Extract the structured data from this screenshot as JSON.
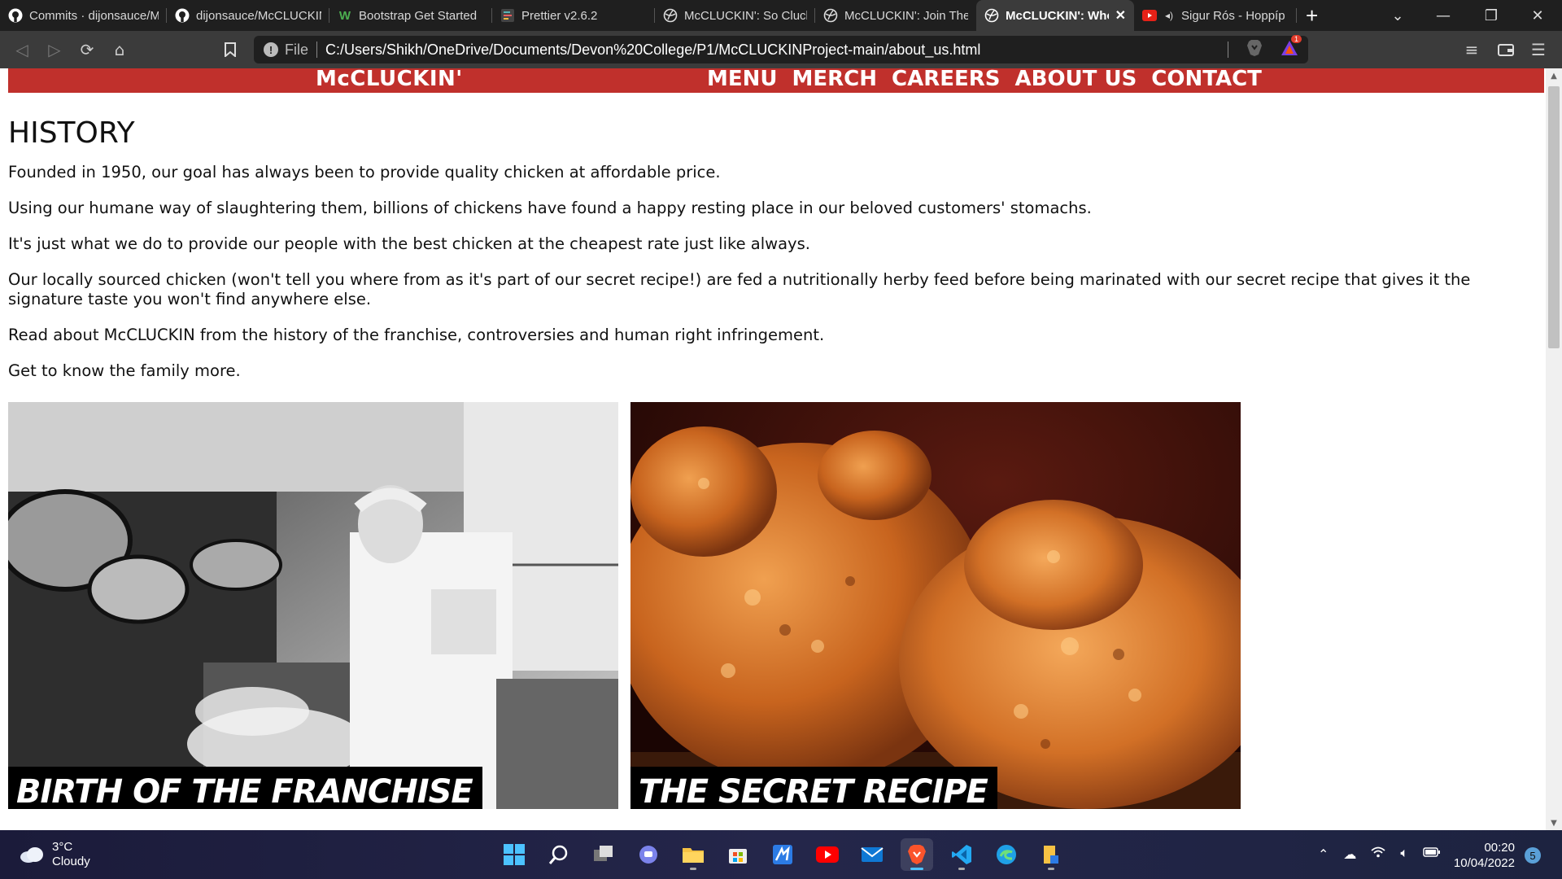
{
  "browser": {
    "tabs": [
      {
        "title": "Commits · dijonsauce/M",
        "icon": "github-icon"
      },
      {
        "title": "dijonsauce/McCLUCKIN",
        "icon": "github-icon"
      },
      {
        "title": "Bootstrap Get Started",
        "icon": "w3schools-icon"
      },
      {
        "title": "Prettier v2.6.2",
        "icon": "prettier-icon"
      },
      {
        "title": "McCLUCKIN': So Clucki",
        "icon": "globe-icon"
      },
      {
        "title": "McCLUCKIN': Join The",
        "icon": "globe-icon"
      },
      {
        "title": "McCLUCKIN': Who",
        "icon": "globe-icon",
        "active": true
      },
      {
        "title": "Sigur Rós - Hoppíp",
        "icon": "youtube-icon"
      }
    ],
    "new_tab": "+",
    "url_scheme": "File",
    "url": "C:/Users/Shikh/OneDrive/Documents/Devon%20College/P1/McCLUCKINProject-main/about_us.html",
    "brave_badge_count": "1"
  },
  "site": {
    "brand": "McCLUCKIN'",
    "nav": [
      "MENU",
      "MERCH",
      "CAREERS",
      "ABOUT US",
      "CONTACT"
    ],
    "nav_color": "#c0302c"
  },
  "page": {
    "heading": "HISTORY",
    "paragraphs": [
      "Founded in 1950, our goal has always been to provide quality chicken at affordable price.",
      "Using our humane way of slaughtering them, billions of chickens have found a happy resting place in our beloved customers' stomachs.",
      "It's just what we do to provide our people with the best chicken at the cheapest rate just like always.",
      "Our locally sourced chicken (won't tell you where from as it's part of our secret recipe!) are fed a nutritionally herby feed before being marinated with our secret recipe that gives it the signature taste you won't find anywhere else.",
      "Read about McCLUCKIN from the history of the franchise, controversies and human right infringement.",
      "Get to know the family more."
    ],
    "cards": [
      {
        "caption": "BIRTH OF THE FRANCHISE",
        "image": "black-and-white photo of elderly chef in kitchen"
      },
      {
        "caption": "THE SECRET RECIPE",
        "image": "fried chicken pieces"
      }
    ]
  },
  "taskbar": {
    "weather_temp": "3°C",
    "weather_desc": "Cloudy",
    "time": "00:20",
    "date": "10/04/2022",
    "notifications": "5"
  }
}
